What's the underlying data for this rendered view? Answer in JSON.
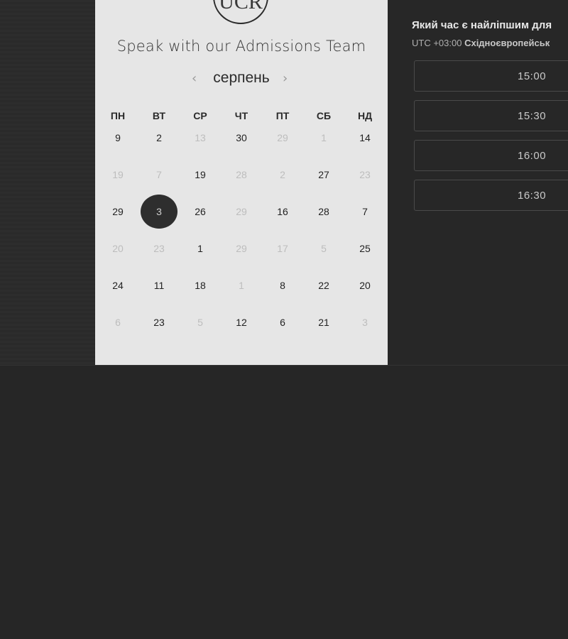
{
  "booking": {
    "logo_text": "UCR",
    "title": "Speak with our Admissions Team",
    "month": "серпень",
    "prev_icon": "‹",
    "next_icon": "›",
    "weekdays": [
      "ПН",
      "ВТ",
      "СР",
      "ЧТ",
      "ПТ",
      "СБ",
      "НД"
    ],
    "days": [
      [
        "9",
        "2",
        "13",
        "30",
        "29",
        "1",
        "14"
      ],
      [
        "19",
        "7",
        "19",
        "28",
        "2",
        "27",
        "23"
      ],
      [
        "29",
        "3",
        "26",
        "29",
        "16",
        "28",
        "7"
      ],
      [
        "20",
        "23",
        "1",
        "29",
        "17",
        "5",
        "25"
      ],
      [
        "24",
        "11",
        "18",
        "1",
        "8",
        "22",
        "20"
      ],
      [
        "6",
        "23",
        "5",
        "12",
        "6",
        "21",
        "3"
      ]
    ],
    "disabled": [
      [
        false,
        false,
        true,
        false,
        true,
        true,
        false
      ],
      [
        true,
        true,
        false,
        true,
        true,
        false,
        true
      ],
      [
        false,
        false,
        false,
        true,
        false,
        false,
        false
      ],
      [
        true,
        true,
        false,
        true,
        true,
        true,
        false
      ],
      [
        false,
        false,
        false,
        true,
        false,
        false,
        false
      ],
      [
        true,
        false,
        true,
        false,
        false,
        false,
        true
      ]
    ],
    "selected": {
      "row": 2,
      "col": 1
    }
  },
  "time_panel": {
    "question": "Який час є найліпшим для",
    "tz_offset": "UTC +03:00",
    "tz_name": "Східноєвропейськ",
    "slots": [
      "15:00",
      "15:30",
      "16:00",
      "16:30"
    ]
  }
}
